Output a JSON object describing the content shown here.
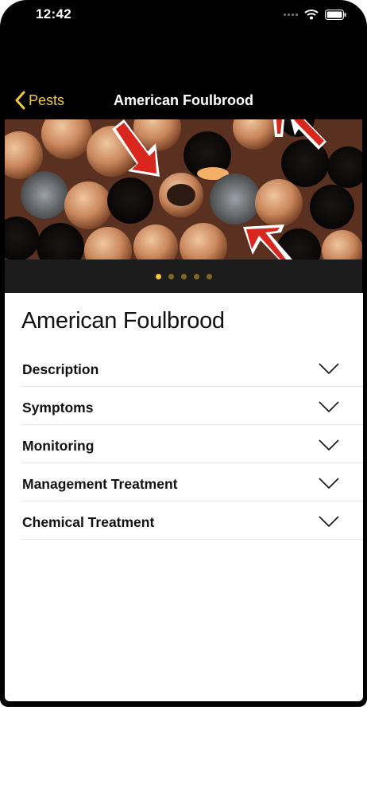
{
  "status_bar": {
    "time": "12:42"
  },
  "nav": {
    "back_label": "Pests",
    "title": "American Foulbrood"
  },
  "gallery": {
    "page_count": 5,
    "current_page": 1
  },
  "content": {
    "title": "American Foulbrood",
    "sections": [
      {
        "label": "Description"
      },
      {
        "label": "Symptoms"
      },
      {
        "label": "Monitoring"
      },
      {
        "label": "Management Treatment"
      },
      {
        "label": "Chemical Treatment"
      }
    ]
  },
  "colors": {
    "accent": "#f2c744",
    "arrow": "#d9271e"
  }
}
